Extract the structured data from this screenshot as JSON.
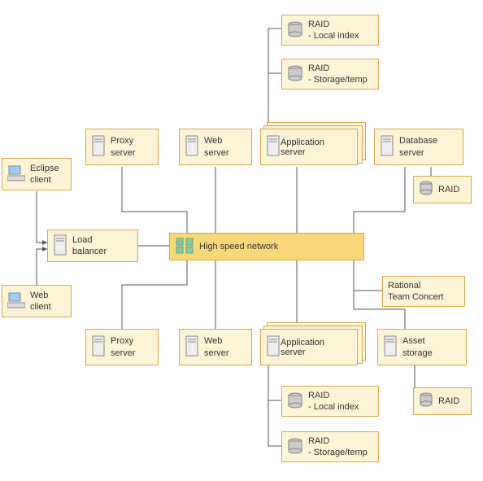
{
  "nodes": {
    "raid_local_top": {
      "title": "RAID",
      "sub": "- Local index"
    },
    "raid_storage_top": {
      "title": "RAID",
      "sub": "- Storage/temp"
    },
    "proxy_top": "Proxy\nserver",
    "web_top": "Web\nserver",
    "app_top": "Application\nserver",
    "db_server": "Database\nserver",
    "raid_db": "RAID",
    "eclipse": "Eclipse\nclient",
    "load_balancer": "Load\nbalancer",
    "network": "High speed network",
    "web_client": "Web\nclient",
    "rtc": "Rational\nTeam Concert",
    "proxy_bot": "Proxy\nserver",
    "web_bot": "Web\nserver",
    "app_bot": "Application\nserver",
    "asset": "Asset\nstorage",
    "raid_local_bot": {
      "title": "RAID",
      "sub": "- Local index"
    },
    "raid_storage_bot": {
      "title": "RAID",
      "sub": "- Storage/temp"
    },
    "raid_asset": "RAID"
  }
}
